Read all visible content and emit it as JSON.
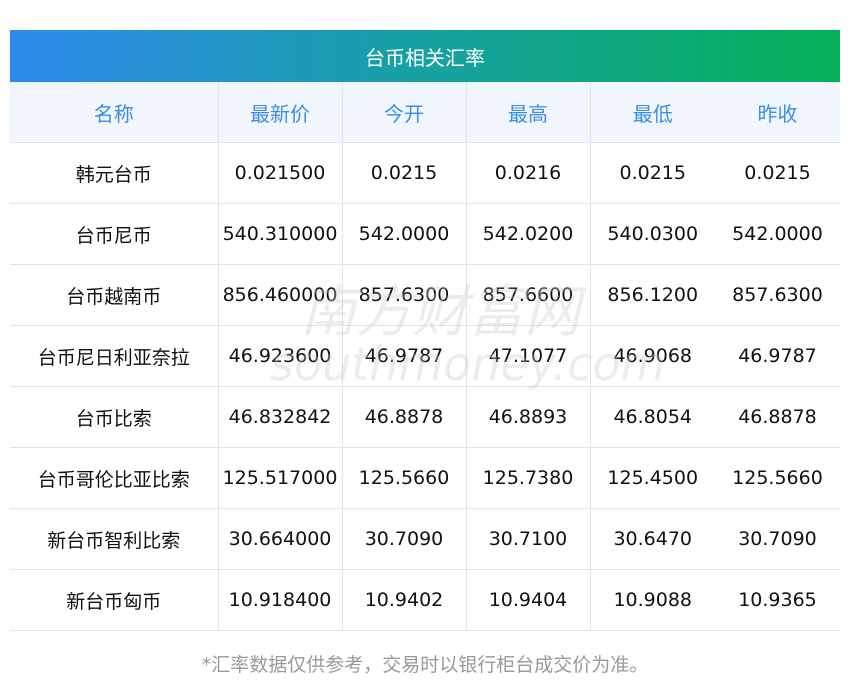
{
  "title": "台币相关汇率",
  "columns": [
    "名称",
    "最新价",
    "今开",
    "最高",
    "最低",
    "昨收"
  ],
  "rows": [
    [
      "韩元台币",
      "0.021500",
      "0.0215",
      "0.0216",
      "0.0215",
      "0.0215"
    ],
    [
      "台币尼币",
      "540.310000",
      "542.0000",
      "542.0200",
      "540.0300",
      "542.0000"
    ],
    [
      "台币越南币",
      "856.460000",
      "857.6300",
      "857.6600",
      "856.1200",
      "857.6300"
    ],
    [
      "台币尼日利亚奈拉",
      "46.923600",
      "46.9787",
      "47.1077",
      "46.9068",
      "46.9787"
    ],
    [
      "台币比索",
      "46.832842",
      "46.8878",
      "46.8893",
      "46.8054",
      "46.8878"
    ],
    [
      "台币哥伦比亚比索",
      "125.517000",
      "125.5660",
      "125.7380",
      "125.4500",
      "125.5660"
    ],
    [
      "新台币智利比索",
      "30.664000",
      "30.7090",
      "30.7100",
      "30.6470",
      "30.7090"
    ],
    [
      "新台币匈币",
      "10.918400",
      "10.9402",
      "10.9404",
      "10.9088",
      "10.9365"
    ]
  ],
  "watermark": {
    "cn": "南方财富网",
    "en": "southmoney.com"
  },
  "footnote": "*汇率数据仅供参考，交易时以银行柜台成交价为准。"
}
